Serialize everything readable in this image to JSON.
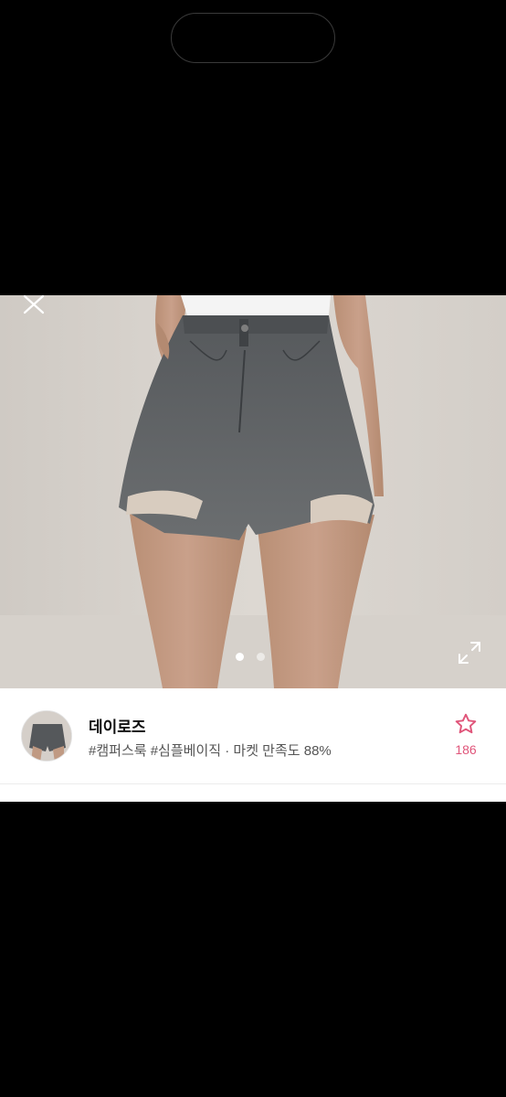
{
  "shop": {
    "name": "데이로즈",
    "tags": "#캠퍼스룩 #심플베이직",
    "separator": " · ",
    "satisfaction": "마켓 만족도 88%",
    "favorite_count": "186"
  },
  "carousel": {
    "total": 2,
    "current": 1
  },
  "colors": {
    "accent": "#e0557a",
    "background": "#000000"
  },
  "icons": [
    "close-icon",
    "expand-icon",
    "star-icon"
  ]
}
